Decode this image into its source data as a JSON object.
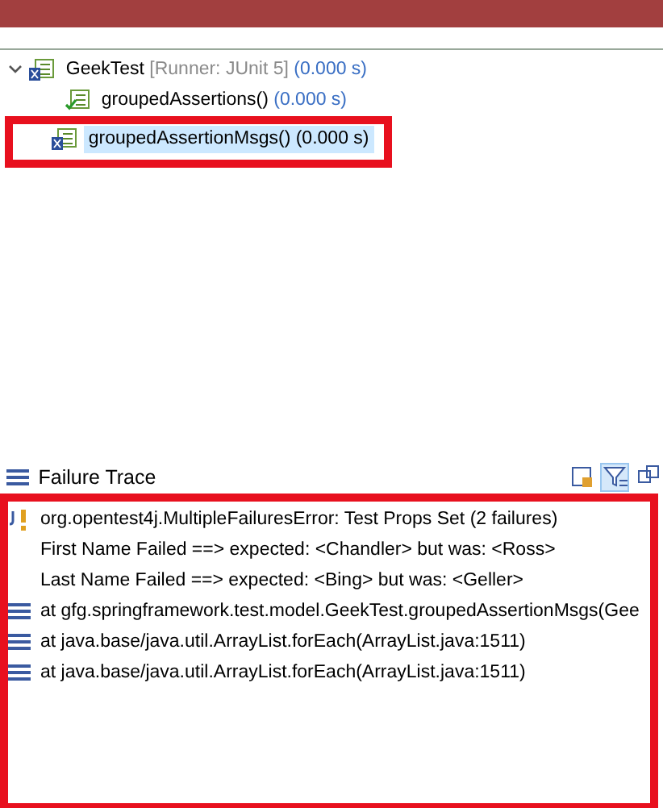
{
  "progress_bar": {
    "level": 1
  },
  "test_tree": [
    {
      "name": "GeekTest",
      "detail": "[Runner: JUnit 5]",
      "time": "(0.000 s)",
      "kind": "error",
      "expanded": true,
      "selected": false,
      "children": [
        {
          "name": "groupedAssertions()",
          "time": "(0.000 s)",
          "kind": "passed",
          "selected": false
        },
        {
          "name": "groupedAssertionMsgs()",
          "time": "(0.000 s)",
          "kind": "error",
          "selected": true,
          "highlighted": true
        }
      ]
    }
  ],
  "failure_trace": {
    "title": "Failure Trace",
    "toolbar": [
      {
        "kind": "compare",
        "selected": false
      },
      {
        "kind": "filter",
        "selected": true
      },
      {
        "kind": "copy",
        "selected": false
      }
    ],
    "highlighted": true,
    "lines": [
      {
        "kind": "error",
        "text": "org.opentest4j.MultipleFailuresError: Test Props Set (2 failures)"
      },
      {
        "kind": "message",
        "text": "First Name Failed ==> expected: <Chandler> but was: <Ross>"
      },
      {
        "kind": "message",
        "text": "Last Name Failed ==> expected: <Bing> but was: <Geller>"
      },
      {
        "kind": "stack",
        "text": "at gfg.springframework.test.model.GeekTest.groupedAssertionMsgs(Gee"
      },
      {
        "kind": "stack",
        "text": "at java.base/java.util.ArrayList.forEach(ArrayList.java:1511)"
      },
      {
        "kind": "stack",
        "text": "at java.base/java.util.ArrayList.forEach(ArrayList.java:1511)"
      }
    ]
  }
}
